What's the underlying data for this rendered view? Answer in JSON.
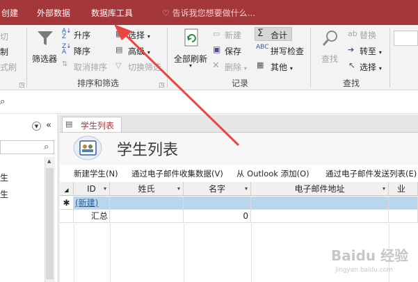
{
  "tabs": [
    {
      "label": "创建"
    },
    {
      "label": "外部数据"
    },
    {
      "label": "数据库工具"
    }
  ],
  "tell_me": "告诉我您想要做什么...",
  "ribbon": {
    "clipboard": {
      "cut": "切",
      "copy": "制",
      "format_painter": "式刷"
    },
    "sort_filter": {
      "filter": "筛选器",
      "ascending": "升序",
      "descending": "降序",
      "remove_sort": "取消排序",
      "selection": "选择",
      "advanced": "高级",
      "toggle_filter": "切换筛选",
      "group_label": "排序和筛选"
    },
    "records": {
      "refresh_all": "全部刷新",
      "new": "新建",
      "save": "保存",
      "delete": "删除",
      "totals": "合计",
      "spelling": "拼写检查",
      "more": "其他",
      "group_label": "记录"
    },
    "find": {
      "find": "查找",
      "replace": "替换",
      "goto": "转至",
      "select": "选择",
      "group_label": "查找"
    }
  },
  "nav": {
    "items": [
      {
        "label": "生"
      },
      {
        "label": "生"
      }
    ]
  },
  "document": {
    "tab_label": "学生列表",
    "form_title": "学生列表",
    "commands": [
      {
        "label": "新建学生(N)"
      },
      {
        "label": "通过电子邮件收集数据(V)"
      },
      {
        "label": "从 Outlook 添加(O)"
      },
      {
        "label": "通过电子邮件发送列表(E)"
      }
    ]
  },
  "grid": {
    "columns": [
      {
        "label": "ID"
      },
      {
        "label": "姓氏"
      },
      {
        "label": "名字"
      },
      {
        "label": "电子邮件地址"
      },
      {
        "label": "业"
      }
    ],
    "new_row_marker": "✱",
    "new_row_label": "(新建)",
    "totals_label": "汇总",
    "totals_value": "0"
  },
  "watermark": {
    "text": "Baidu 经验",
    "url": "jingyan.baidu.com"
  },
  "colors": {
    "tab_bar": "#a4373a",
    "new_row_highlight": "#b9d7ec",
    "form_title_icon": "#2a5d9f"
  }
}
